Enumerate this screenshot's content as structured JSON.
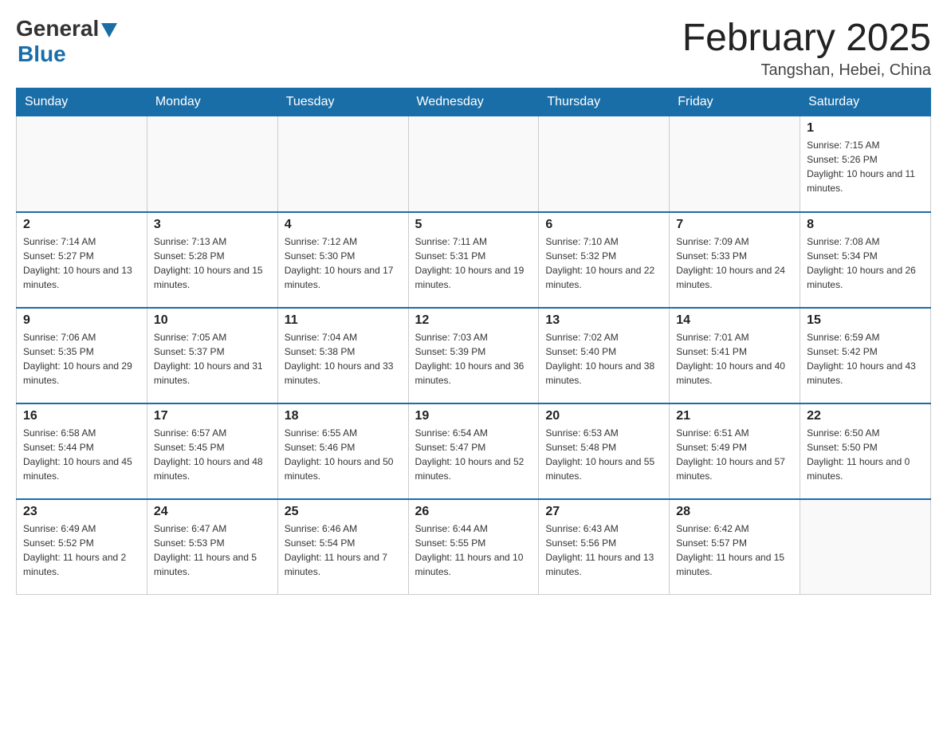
{
  "header": {
    "logo_general": "General",
    "logo_blue": "Blue",
    "title": "February 2025",
    "location": "Tangshan, Hebei, China"
  },
  "weekdays": [
    "Sunday",
    "Monday",
    "Tuesday",
    "Wednesday",
    "Thursday",
    "Friday",
    "Saturday"
  ],
  "weeks": [
    [
      {
        "day": "",
        "info": ""
      },
      {
        "day": "",
        "info": ""
      },
      {
        "day": "",
        "info": ""
      },
      {
        "day": "",
        "info": ""
      },
      {
        "day": "",
        "info": ""
      },
      {
        "day": "",
        "info": ""
      },
      {
        "day": "1",
        "info": "Sunrise: 7:15 AM\nSunset: 5:26 PM\nDaylight: 10 hours and 11 minutes."
      }
    ],
    [
      {
        "day": "2",
        "info": "Sunrise: 7:14 AM\nSunset: 5:27 PM\nDaylight: 10 hours and 13 minutes."
      },
      {
        "day": "3",
        "info": "Sunrise: 7:13 AM\nSunset: 5:28 PM\nDaylight: 10 hours and 15 minutes."
      },
      {
        "day": "4",
        "info": "Sunrise: 7:12 AM\nSunset: 5:30 PM\nDaylight: 10 hours and 17 minutes."
      },
      {
        "day": "5",
        "info": "Sunrise: 7:11 AM\nSunset: 5:31 PM\nDaylight: 10 hours and 19 minutes."
      },
      {
        "day": "6",
        "info": "Sunrise: 7:10 AM\nSunset: 5:32 PM\nDaylight: 10 hours and 22 minutes."
      },
      {
        "day": "7",
        "info": "Sunrise: 7:09 AM\nSunset: 5:33 PM\nDaylight: 10 hours and 24 minutes."
      },
      {
        "day": "8",
        "info": "Sunrise: 7:08 AM\nSunset: 5:34 PM\nDaylight: 10 hours and 26 minutes."
      }
    ],
    [
      {
        "day": "9",
        "info": "Sunrise: 7:06 AM\nSunset: 5:35 PM\nDaylight: 10 hours and 29 minutes."
      },
      {
        "day": "10",
        "info": "Sunrise: 7:05 AM\nSunset: 5:37 PM\nDaylight: 10 hours and 31 minutes."
      },
      {
        "day": "11",
        "info": "Sunrise: 7:04 AM\nSunset: 5:38 PM\nDaylight: 10 hours and 33 minutes."
      },
      {
        "day": "12",
        "info": "Sunrise: 7:03 AM\nSunset: 5:39 PM\nDaylight: 10 hours and 36 minutes."
      },
      {
        "day": "13",
        "info": "Sunrise: 7:02 AM\nSunset: 5:40 PM\nDaylight: 10 hours and 38 minutes."
      },
      {
        "day": "14",
        "info": "Sunrise: 7:01 AM\nSunset: 5:41 PM\nDaylight: 10 hours and 40 minutes."
      },
      {
        "day": "15",
        "info": "Sunrise: 6:59 AM\nSunset: 5:42 PM\nDaylight: 10 hours and 43 minutes."
      }
    ],
    [
      {
        "day": "16",
        "info": "Sunrise: 6:58 AM\nSunset: 5:44 PM\nDaylight: 10 hours and 45 minutes."
      },
      {
        "day": "17",
        "info": "Sunrise: 6:57 AM\nSunset: 5:45 PM\nDaylight: 10 hours and 48 minutes."
      },
      {
        "day": "18",
        "info": "Sunrise: 6:55 AM\nSunset: 5:46 PM\nDaylight: 10 hours and 50 minutes."
      },
      {
        "day": "19",
        "info": "Sunrise: 6:54 AM\nSunset: 5:47 PM\nDaylight: 10 hours and 52 minutes."
      },
      {
        "day": "20",
        "info": "Sunrise: 6:53 AM\nSunset: 5:48 PM\nDaylight: 10 hours and 55 minutes."
      },
      {
        "day": "21",
        "info": "Sunrise: 6:51 AM\nSunset: 5:49 PM\nDaylight: 10 hours and 57 minutes."
      },
      {
        "day": "22",
        "info": "Sunrise: 6:50 AM\nSunset: 5:50 PM\nDaylight: 11 hours and 0 minutes."
      }
    ],
    [
      {
        "day": "23",
        "info": "Sunrise: 6:49 AM\nSunset: 5:52 PM\nDaylight: 11 hours and 2 minutes."
      },
      {
        "day": "24",
        "info": "Sunrise: 6:47 AM\nSunset: 5:53 PM\nDaylight: 11 hours and 5 minutes."
      },
      {
        "day": "25",
        "info": "Sunrise: 6:46 AM\nSunset: 5:54 PM\nDaylight: 11 hours and 7 minutes."
      },
      {
        "day": "26",
        "info": "Sunrise: 6:44 AM\nSunset: 5:55 PM\nDaylight: 11 hours and 10 minutes."
      },
      {
        "day": "27",
        "info": "Sunrise: 6:43 AM\nSunset: 5:56 PM\nDaylight: 11 hours and 13 minutes."
      },
      {
        "day": "28",
        "info": "Sunrise: 6:42 AM\nSunset: 5:57 PM\nDaylight: 11 hours and 15 minutes."
      },
      {
        "day": "",
        "info": ""
      }
    ]
  ]
}
